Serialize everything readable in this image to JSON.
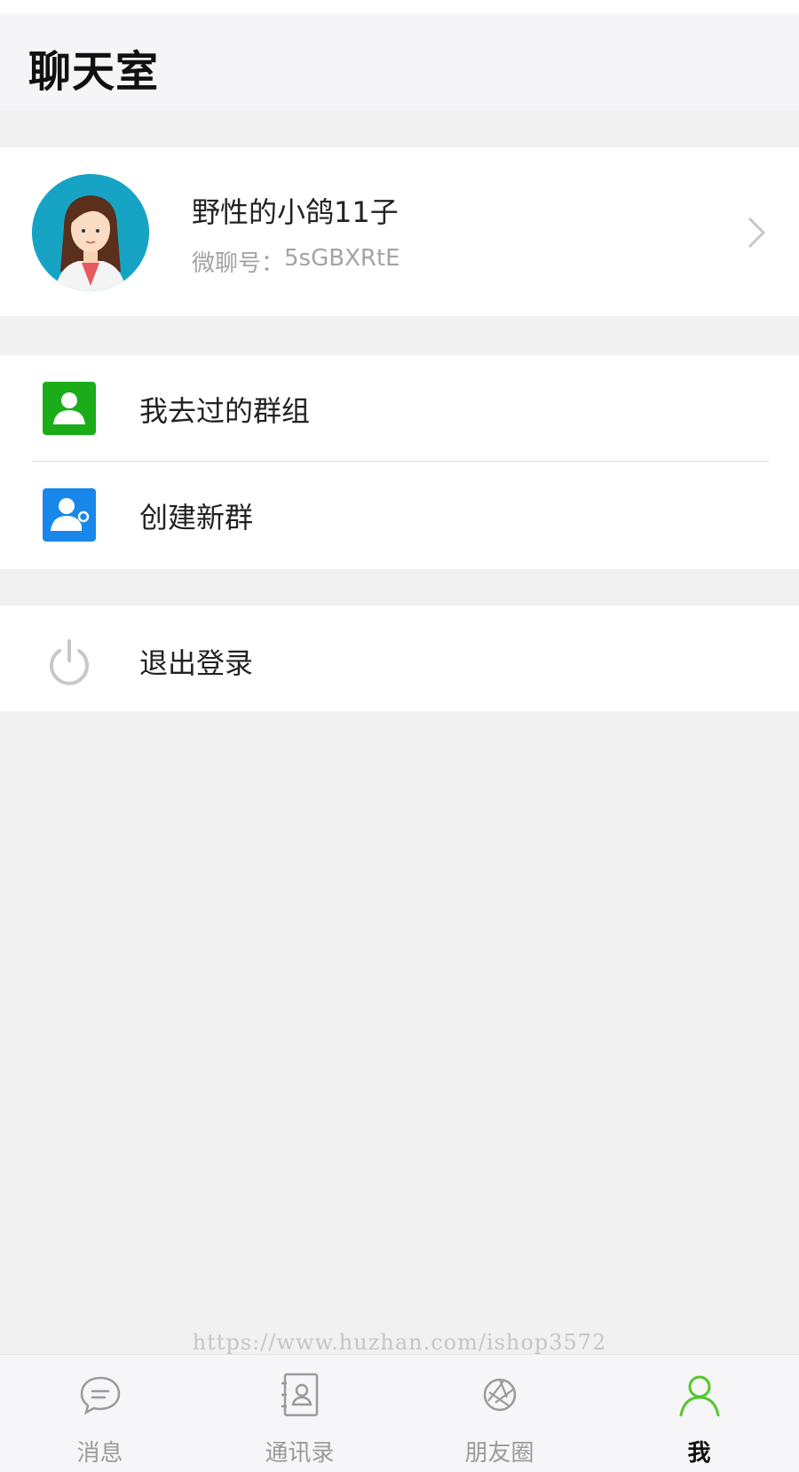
{
  "header": {
    "title": "聊天室"
  },
  "profile": {
    "name": "野性的小鸽11子",
    "id_label": "微聊号：",
    "id_value": "5sGBXRtE"
  },
  "menu": {
    "groups_visited": "我去过的群组",
    "create_group": "创建新群",
    "logout": "退出登录"
  },
  "watermark": "https://www.huzhan.com/ishop3572",
  "tabs": [
    {
      "label": "消息",
      "icon": "message-icon",
      "active": false
    },
    {
      "label": "通讯录",
      "icon": "contacts-icon",
      "active": false
    },
    {
      "label": "朋友圈",
      "icon": "moments-icon",
      "active": false
    },
    {
      "label": "我",
      "icon": "me-icon",
      "active": true
    }
  ],
  "colors": {
    "accent_green": "#1aad19",
    "blue": "#1787ea",
    "avatar_bg": "#17a4c4",
    "active_tab_icon": "#53c72a"
  }
}
